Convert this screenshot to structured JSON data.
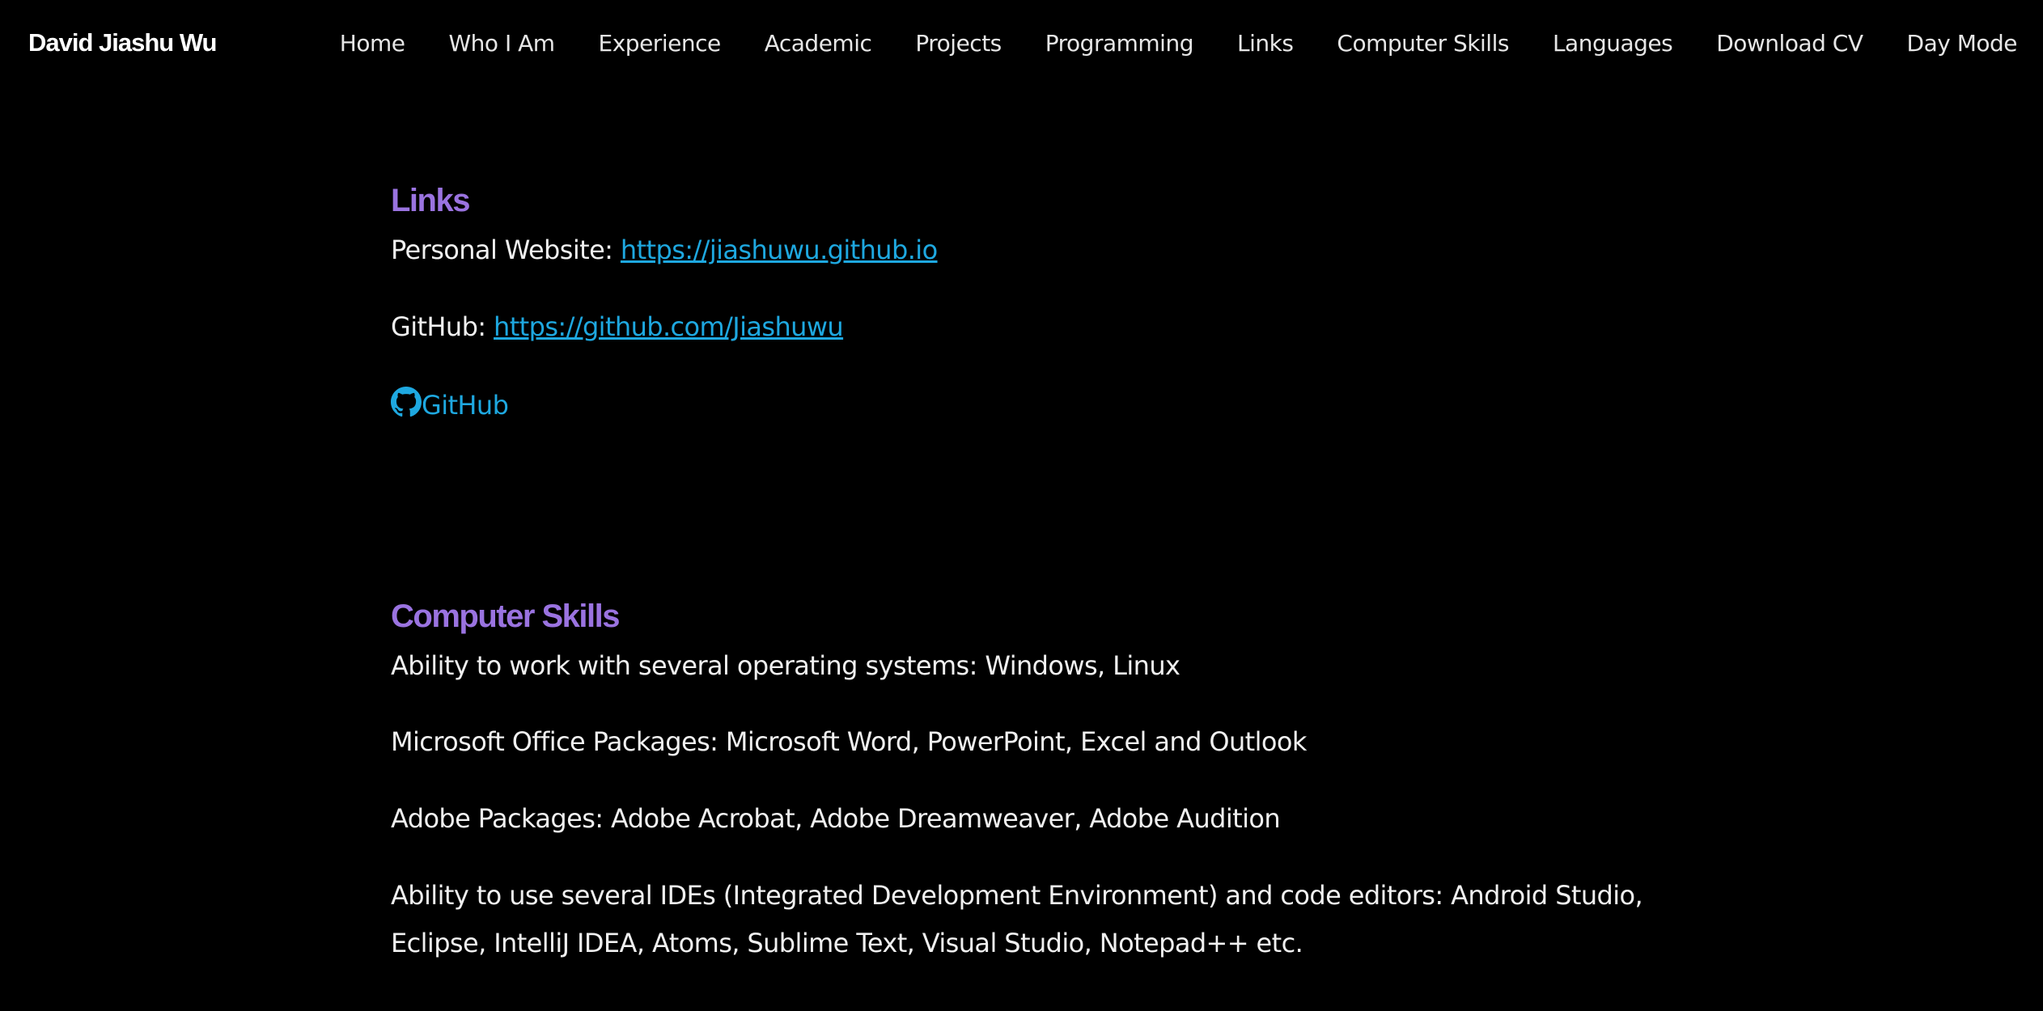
{
  "header": {
    "brand": "David Jiashu Wu",
    "nav": [
      "Home",
      "Who I Am",
      "Experience",
      "Academic",
      "Projects",
      "Programming",
      "Links",
      "Computer Skills",
      "Languages",
      "Download CV",
      "Day Mode"
    ]
  },
  "links_section": {
    "title": "Links",
    "personal_label": "Personal Website: ",
    "personal_url": "https://jiashuwu.github.io",
    "github_label": "GitHub: ",
    "github_url": "https://github.com/Jiashuwu",
    "github_badge": "GitHub",
    "github_icon": "github-icon"
  },
  "skills_section": {
    "title": "Computer Skills",
    "items": [
      "Ability to work with several operating systems: Windows, Linux",
      "Microsoft Office Packages: Microsoft Word, PowerPoint, Excel and Outlook",
      "Adobe Packages: Adobe Acrobat, Adobe Dreamweaver, Adobe Audition",
      "Ability to use several IDEs (Integrated Development Environment) and code editors: Android Studio,",
      "Eclipse, IntelliJ IDEA, Atoms, Sublime Text, Visual Studio, Notepad++ etc."
    ]
  },
  "colors": {
    "background": "#000000",
    "heading": "#9a73e0",
    "link": "#1ea8e0",
    "text": "#f0f0f0"
  }
}
